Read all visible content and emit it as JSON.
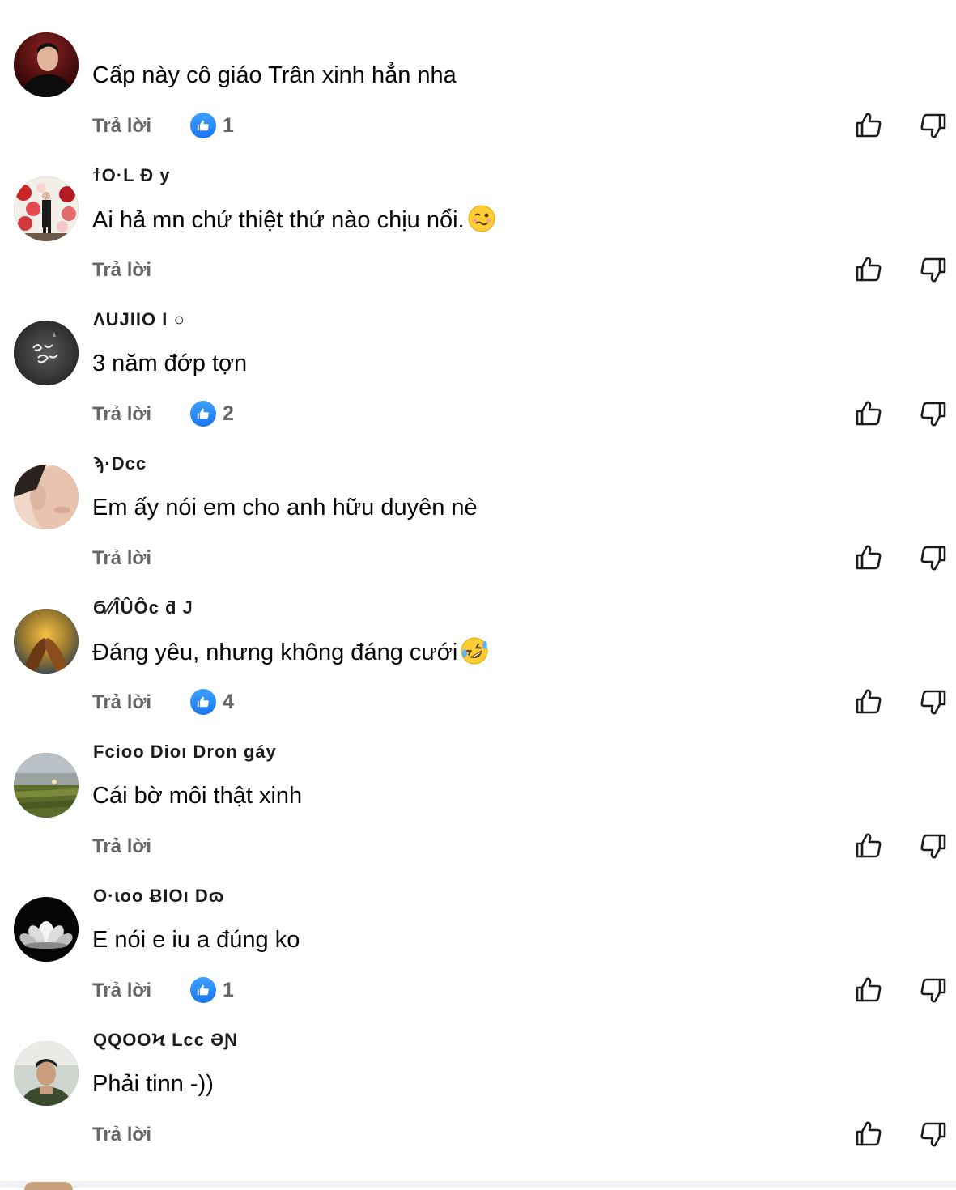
{
  "comments": [
    {
      "name": "",
      "text": "Cấp này cô giáo Trân xinh hẳn nha",
      "reply": "Trả lời",
      "likes": "1",
      "emoji": "",
      "avatar": "man-dark-red"
    },
    {
      "name": "ϯO·L  Ð y",
      "text": "Ai hả mn chứ thiệt thứ nào chịu nổi.",
      "reply": "Trả lời",
      "likes": "",
      "emoji": "woozy-face",
      "avatar": "flowers"
    },
    {
      "name": "ɅUJIIO I  ○",
      "text": "3 năm đớp tợn",
      "reply": "Trả lời",
      "likes": "2",
      "emoji": "",
      "avatar": "dark-calligraphy"
    },
    {
      "name": "ϡ·Dcc",
      "text": "Em ấy nói em cho anh hữu duyên nè",
      "reply": "Trả lời",
      "likes": "",
      "emoji": "",
      "avatar": "face-closeup"
    },
    {
      "name": "Ϭ⁄⁄ÎÛÔc  ƌ J",
      "text": "Đáng yêu, nhưng không đáng cưới",
      "reply": "Trả lời",
      "likes": "4",
      "emoji": "rofl-face",
      "avatar": "hands-sunset"
    },
    {
      "name": "Fcioo Dioı  Dron  gáy",
      "text": "Cái bờ môi thật xinh",
      "reply": "Trả lời",
      "likes": "",
      "emoji": "",
      "avatar": "field-landscape"
    },
    {
      "name": "O·ɩoo ɃIOı  Dɷ",
      "text": "E nói e iu a đúng ko",
      "reply": "Trả lời",
      "likes": "1",
      "emoji": "",
      "avatar": "white-lotus"
    },
    {
      "name": "QQOOϞ  Lcc  ƏƝ",
      "text": "Phải tinn -))",
      "reply": "Trả lời",
      "likes": "",
      "emoji": "",
      "avatar": "man-selfie"
    }
  ],
  "colors": {
    "like_blue": "#1876f2",
    "meta_gray": "#65676b",
    "text": "#050505"
  },
  "icons": {
    "like_badge": "thumbs-up-icon",
    "upvote": "thumbs-up-outline-icon",
    "downvote": "thumbs-down-outline-icon"
  }
}
